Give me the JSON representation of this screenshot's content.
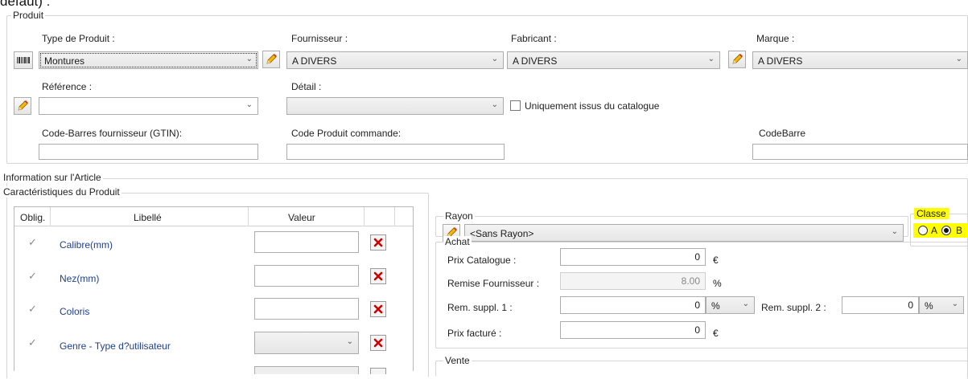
{
  "top_text": "défaut) :",
  "produit": {
    "legend": "Produit",
    "type_label": "Type de Produit :",
    "type_value": "Montures",
    "fournisseur_label": "Fournisseur :",
    "fournisseur_value": "A DIVERS",
    "fabricant_label": "Fabricant :",
    "fabricant_value": "A DIVERS",
    "marque_label": "Marque :",
    "marque_value": "A DIVERS",
    "reference_label": "Référence :",
    "reference_value": "",
    "detail_label": "Détail :",
    "detail_value": "",
    "catalogue_checkbox_label": "Uniquement issus du catalogue",
    "gtin_label": "Code-Barres fournisseur (GTIN):",
    "code_commande_label": "Code Produit commande:",
    "codebarre_label": "CodeBarre"
  },
  "article": {
    "legend": "Information sur l'Article",
    "caracteristiques_legend": "Caractéristiques du Produit",
    "columns": [
      "Oblig.",
      "Libellé",
      "Valeur"
    ],
    "rows": [
      {
        "label": "Calibre(mm)",
        "input": "text"
      },
      {
        "label": "Nez(mm)",
        "input": "text"
      },
      {
        "label": "Coloris",
        "input": "text"
      },
      {
        "label": "Genre - Type d?utilisateur",
        "input": "combo"
      }
    ],
    "rayon_legend": "Rayon",
    "rayon_value": "<Sans Rayon>",
    "classe_legend": "Classe",
    "classe_options": [
      "A",
      "B"
    ],
    "classe_selected": "B",
    "achat_legend": "Achat",
    "prix_catalogue_label": "Prix Catalogue :",
    "prix_catalogue_value": "0",
    "euro": "€",
    "remise_label": "Remise Fournisseur :",
    "remise_value": "8.00",
    "percent": "%",
    "rem1_label": "Rem. suppl. 1 :",
    "rem1_value": "0",
    "rem1_unit": "%",
    "rem2_label": "Rem. suppl. 2 :",
    "rem2_value": "0",
    "rem2_unit": "%",
    "prix_facture_label": "Prix facturé :",
    "prix_facture_value": "0",
    "vente_legend": "Vente"
  },
  "icons": {
    "barcode": "barcode-icon",
    "pencil": "pencil-icon",
    "delete": "red-x-delete-icon",
    "chevron": "chevron-down-icon"
  },
  "colors": {
    "highlight": "#ffff00",
    "delete_red": "#cc0000",
    "label_blue": "#1f3f8f"
  }
}
